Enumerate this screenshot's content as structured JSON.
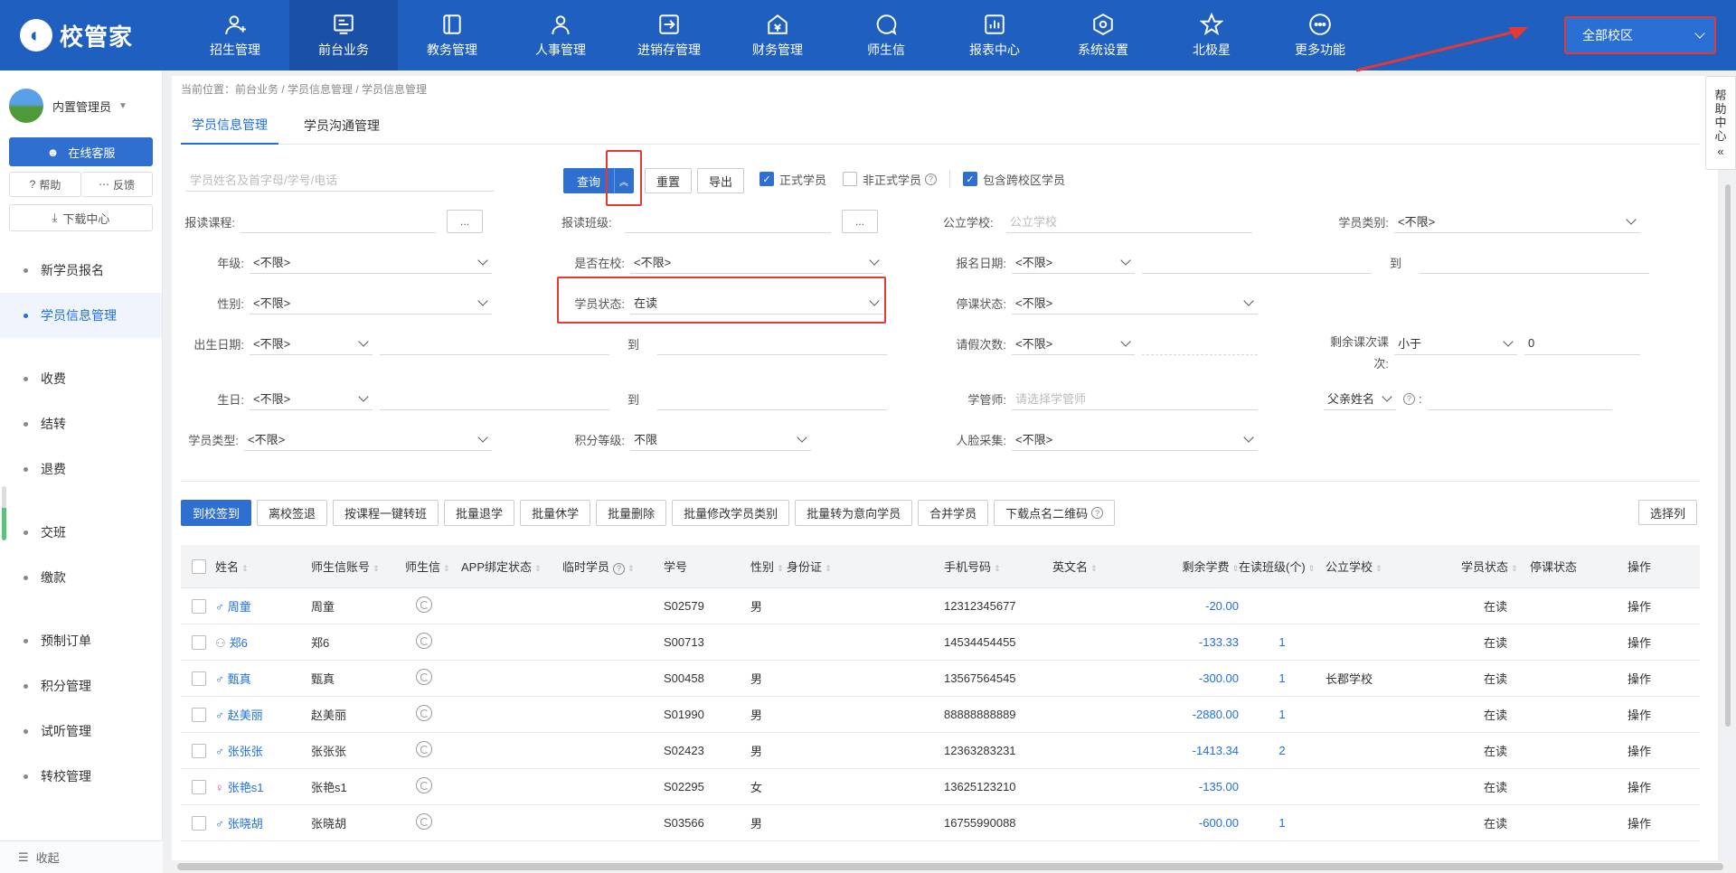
{
  "logo": {
    "text": "校管家"
  },
  "nav": [
    {
      "label": "招生管理",
      "icon": "user-add-icon"
    },
    {
      "label": "前台业务",
      "icon": "monitor-icon"
    },
    {
      "label": "教务管理",
      "icon": "book-icon"
    },
    {
      "label": "人事管理",
      "icon": "person-icon"
    },
    {
      "label": "进销存管理",
      "icon": "inout-icon"
    },
    {
      "label": "财务管理",
      "icon": "money-icon"
    },
    {
      "label": "师生信",
      "icon": "chat-icon"
    },
    {
      "label": "报表中心",
      "icon": "chart-icon"
    },
    {
      "label": "系统设置",
      "icon": "settings-icon"
    },
    {
      "label": "北极星",
      "icon": "star-icon"
    },
    {
      "label": "更多功能",
      "icon": "more-icon"
    }
  ],
  "campus": {
    "selected": "全部校区"
  },
  "sidebar": {
    "user": "内置管理员",
    "service": "在线客服",
    "help": "帮助",
    "feedback": "反馈",
    "download": "下载中心",
    "items": [
      "新学员报名",
      "学员信息管理",
      "收费",
      "结转",
      "退费",
      "交班",
      "缴款",
      "预制订单",
      "积分管理",
      "试听管理",
      "转校管理"
    ],
    "collapse": "收起"
  },
  "breadcrumb": "当前位置：前台业务 / 学员信息管理 / 学员信息管理",
  "tabs": [
    "学员信息管理",
    "学员沟通管理"
  ],
  "search": {
    "placeholder": "学员姓名及首字母/学号/电话",
    "query": "查询",
    "reset": "重置",
    "export": "导出",
    "formal": "正式学员",
    "informal": "非正式学员",
    "cross": "包含跨校区学员"
  },
  "filters": {
    "course": "报读课程:",
    "class": "报读班级:",
    "public_school": "公立学校:",
    "public_school_ph": "公立学校",
    "student_type_cat": "学员类别:",
    "grade": "年级:",
    "in_school": "是否在校:",
    "reg_date": "报名日期:",
    "gender": "性别:",
    "status": "学员状态:",
    "status_val": "在读",
    "suspend": "停课状态:",
    "birthdate": "出生日期:",
    "leave": "请假次数:",
    "remain": "剩余课次课次:",
    "remain_op": "小于",
    "remain_val": "0",
    "birthday": "生日:",
    "manager": "学管师:",
    "manager_ph": "请选择学管师",
    "father": "父亲姓名",
    "stype": "学员类型:",
    "points": "积分等级:",
    "points_val": "不限",
    "face": "人脸采集:",
    "unlimited": "<不限>",
    "to": "到",
    "ellipsis": "..."
  },
  "actions": [
    "到校签到",
    "离校签退",
    "按课程一键转班",
    "批量退学",
    "批量休学",
    "批量删除",
    "批量修改学员类别",
    "批量转为意向学员",
    "合并学员",
    "下载点名二维码"
  ],
  "select_cols": "选择列",
  "table": {
    "headers": [
      "姓名",
      "师生信账号",
      "师生信",
      "APP绑定状态",
      "临时学员",
      "学号",
      "性别",
      "身份证",
      "手机号码",
      "英文名",
      "剩余学费",
      "在读班级(个)",
      "公立学校",
      "学员状态",
      "停课状态",
      "操作"
    ],
    "rows": [
      {
        "g": "m",
        "name": "周童",
        "acct": "周童",
        "no": "S02579",
        "sex": "男",
        "phone": "12312345677",
        "fee": "-20.00",
        "cls": "",
        "school": "",
        "status": "在读",
        "op": "操作"
      },
      {
        "g": "u",
        "name": "郑6",
        "acct": "郑6",
        "no": "S00713",
        "sex": "",
        "phone": "14534454455",
        "fee": "-133.33",
        "cls": "1",
        "school": "",
        "status": "在读",
        "op": "操作"
      },
      {
        "g": "m",
        "name": "甄真",
        "acct": "甄真",
        "no": "S00458",
        "sex": "男",
        "phone": "13567564545",
        "fee": "-300.00",
        "cls": "1",
        "school": "长郡学校",
        "status": "在读",
        "op": "操作"
      },
      {
        "g": "m",
        "name": "赵美丽",
        "acct": "赵美丽",
        "no": "S01990",
        "sex": "男",
        "phone": "88888888889",
        "fee": "-2880.00",
        "cls": "1",
        "school": "",
        "status": "在读",
        "op": "操作"
      },
      {
        "g": "m",
        "name": "张张张",
        "acct": "张张张",
        "no": "S02423",
        "sex": "男",
        "phone": "12363283231",
        "fee": "-1413.34",
        "cls": "2",
        "school": "",
        "status": "在读",
        "op": "操作"
      },
      {
        "g": "f",
        "name": "张艳s1",
        "acct": "张艳s1",
        "no": "S02295",
        "sex": "女",
        "phone": "13625123210",
        "fee": "-135.00",
        "cls": "",
        "school": "",
        "status": "在读",
        "op": "操作"
      },
      {
        "g": "m",
        "name": "张晓胡",
        "acct": "张晓胡",
        "no": "S03566",
        "sex": "男",
        "phone": "16755990088",
        "fee": "-600.00",
        "cls": "1",
        "school": "",
        "status": "在读",
        "op": "操作"
      }
    ]
  },
  "help_float": "帮助中心"
}
